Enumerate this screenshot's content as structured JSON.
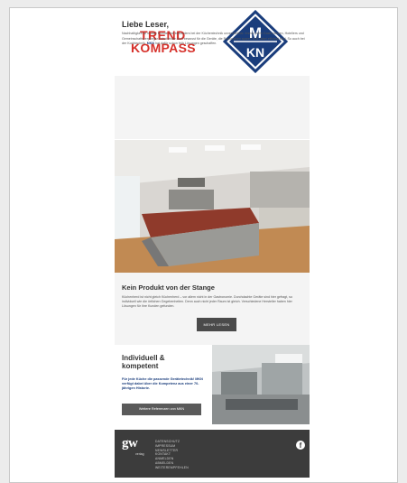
{
  "header": {
    "logo_text_line1": "TREND",
    "logo_text_line2": "KOMPASS",
    "brand_logo_text": "MKN"
  },
  "intro": {
    "greeting": "Liebe Leser,",
    "text_lead": "Nachhaltigkeit ist in aller Munde und besonders bei der Küchentechnik unverzichtbar. Immer mehr Gastronomen, Hoteliers und Gemeinschaftsverpfleger entscheiden sich bewusst für die Geräte, die Ressourcen sparen und dabei effizient sind. So auch bei der Kochtechnik. ",
    "text_brand": "MKN",
    "text_tail": " hat dafür schon früh Lösungen geschaffen."
  },
  "product": {
    "heading": "Kein Produkt von der Stange",
    "text": "Küchenherd ist nicht gleich Küchenherd – vor allem nicht in der Gastronomie. Durchdachte Geräte sind hier gefragt, so individuell wie die örtlichen Gegebenheiten. Denn auch nicht jeder Raum ist gleich. Verschiedene Hersteller haben hier Lösungen für ihre Kunden gefunden.",
    "button_label": "MEHR LESEN"
  },
  "individual": {
    "heading": "Individuell & kompetent",
    "text": "Für jede Küche die passende Gerätetechnik! MKN verfügt dabei über die Kompetenz aus einer 70-jährigen Historie.",
    "button_label": "Weitere Referenzen von MKN"
  },
  "footer": {
    "logo_text": "gw",
    "logo_sub": "verlag",
    "links": [
      "DATENSCHUTZ",
      "IMPRESSUM",
      "NEWSLETTER",
      "KONTAKT",
      "ANMELDEN",
      "ABMELDEN",
      "WEITEREMPFEHLEN"
    ],
    "social_icon": "f"
  },
  "colors": {
    "brand_red": "#d6312b",
    "brand_blue": "#1a3d7c",
    "footer_bg": "#3c3c3c",
    "button_bg": "#4a4a4a"
  }
}
